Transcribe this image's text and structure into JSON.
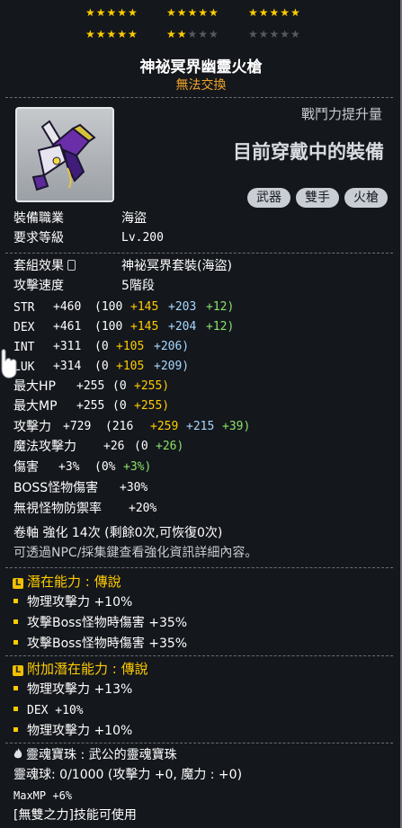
{
  "stars": {
    "row1": [
      "★★★★★",
      "★★★★★",
      "★★★★★"
    ],
    "row2_on": [
      "★★★★★",
      "★★",
      ""
    ],
    "row2_off": [
      "",
      "★★★",
      "★★★★★"
    ]
  },
  "item": {
    "name": "神祕冥界幽靈火槍",
    "trade": "無法交換",
    "power_label": "戰鬥力提升量",
    "equipped": "目前穿戴中的裝備",
    "tags": [
      "武器",
      "雙手",
      "火槍"
    ]
  },
  "info": {
    "job_label": "裝備職業",
    "job_value": "海盜",
    "level_label": "要求等級",
    "level_value": "Lv.200",
    "set_label": "套組效果",
    "set_value": "神祕冥界套裝(海盜)",
    "speed_label": "攻擊速度",
    "speed_value": "5階段"
  },
  "stats": [
    {
      "label": "STR",
      "total": "+460",
      "base": "(100",
      "p1": "+145",
      "p2": "+203",
      "p3": "+12)"
    },
    {
      "label": "DEX",
      "total": "+461",
      "base": "(100",
      "p1": "+145",
      "p2": "+204",
      "p3": "+12)"
    },
    {
      "label": "INT",
      "total": "+311",
      "base": "(0",
      "p1": "+105",
      "p2": "+206)",
      "p3": ""
    },
    {
      "label": "LUK",
      "total": "+314",
      "base": "(0",
      "p1": "+105",
      "p2": "+209)",
      "p3": ""
    },
    {
      "label": "最大HP",
      "total": "+255",
      "base": "(0",
      "p1": "+255)",
      "p2": "",
      "p3": ""
    },
    {
      "label": "最大MP",
      "total": "+255",
      "base": "(0",
      "p1": "+255)",
      "p2": "",
      "p3": ""
    },
    {
      "label": "攻擊力",
      "total": "+729",
      "base": "(216",
      "p1": "+259",
      "p2": "+215",
      "p3": "+39)"
    },
    {
      "label": "魔法攻擊力",
      "total": "+26",
      "base": "(0",
      "p1": "",
      "p2": "",
      "p3": "+26)"
    },
    {
      "label": "傷害",
      "total": "+3%",
      "base": "(0%",
      "p1": "",
      "p2": "",
      "p3": "+3%)"
    }
  ],
  "extra": {
    "boss": "BOSS怪物傷害",
    "boss_val": "+30%",
    "ignore": "無視怪物防禦率",
    "ignore_val": "+20%",
    "enhance": "卷軸 強化 14次 (剩餘0次,可恢復0次)",
    "hint": "可透過NPC/採集鍵查看強化資訊詳細內容。"
  },
  "potential": {
    "head": "潛在能力 : 傳說",
    "lines": [
      "物理攻擊力 +10%",
      "攻擊Boss怪物時傷害 +35%",
      "攻擊Boss怪物時傷害 +35%"
    ]
  },
  "bonus": {
    "head": "附加潛在能力 : 傳說",
    "lines": [
      "物理攻擊力 +13%",
      "DEX +10%",
      "物理攻擊力 +10%"
    ]
  },
  "soul": {
    "line1": "靈魂寶珠 : 武公的靈魂寶珠",
    "line2": "靈魂球: 0/1000 (攻擊力 +0, 魔力 : +0)",
    "line3": "MaxMP +6%",
    "line4": "[無雙之力]技能可使用"
  },
  "colors": {
    "star_on": "#ffcc00",
    "star_off": "#555a60",
    "trade": "#f0a52b",
    "blue_bonus": "#a7d8ff",
    "green_bonus": "#8be36a",
    "potential": "#ffcc00"
  },
  "icons": [
    "lock-icon",
    "flame-icon",
    "glove-cursor-icon",
    "gun-item-icon",
    "potential-badge-icon"
  ]
}
